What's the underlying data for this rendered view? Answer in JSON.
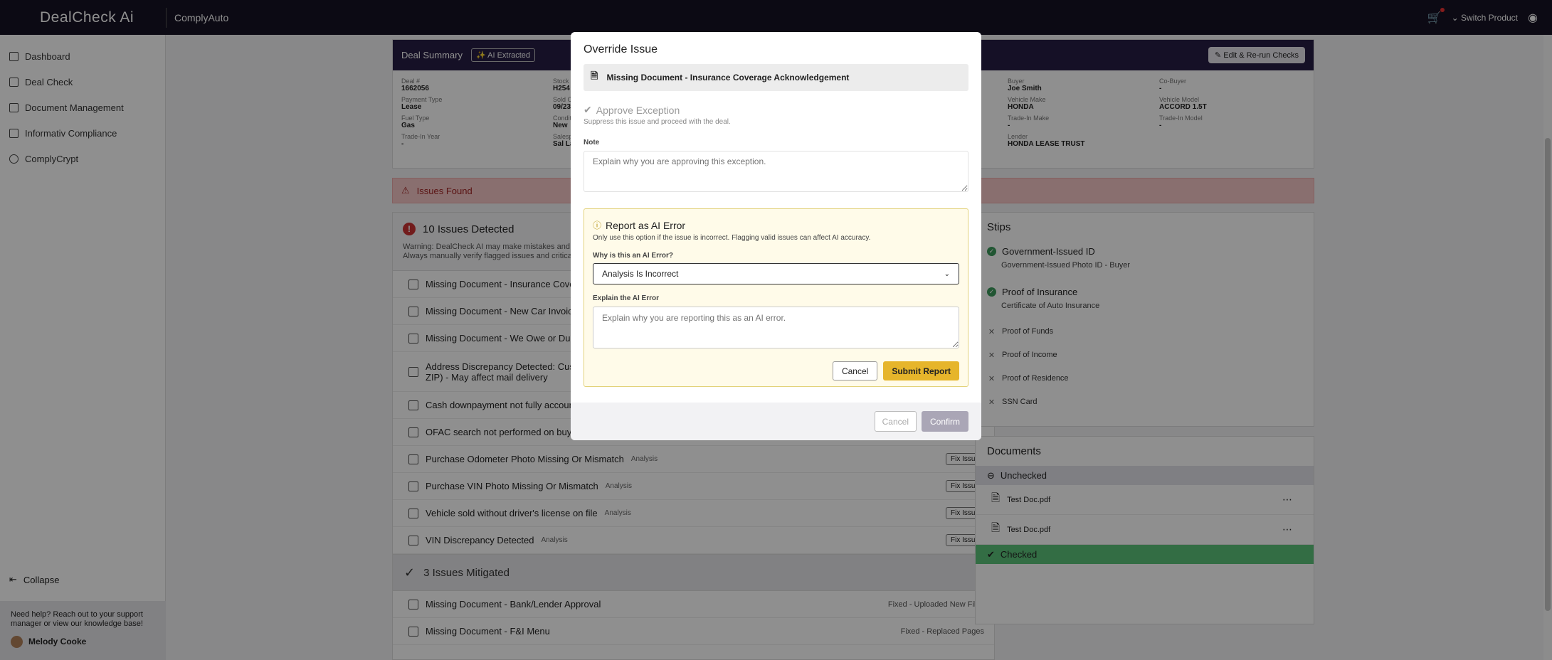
{
  "topbar": {
    "logo": "DealCheck Ai",
    "product": "ComplyAuto",
    "switch_product": "Switch Product"
  },
  "sidebar": {
    "items": [
      {
        "label": "Dashboard"
      },
      {
        "label": "Deal Check"
      },
      {
        "label": "Document Management"
      },
      {
        "label": "Informativ Compliance"
      },
      {
        "label": "ComplyCrypt"
      }
    ],
    "collapse": "Collapse",
    "help": "Need help? Reach out to your support manager or view our knowledge base!",
    "user": "Melody Cooke"
  },
  "summary": {
    "title": "Deal Summary",
    "ai_badge": "AI Extracted",
    "rerun": "Edit & Re-run Checks",
    "fields": [
      {
        "label": "Deal #",
        "value": "1662056"
      },
      {
        "label": "Stock",
        "value": "H254"
      },
      {
        "label": "",
        "value": ""
      },
      {
        "label": "",
        "value": ""
      },
      {
        "label": "Buyer",
        "value": "Joe Smith"
      },
      {
        "label": "Co-Buyer",
        "value": "-"
      },
      {
        "label": "Payment Type",
        "value": "Lease"
      },
      {
        "label": "Sold C",
        "value": "09/23"
      },
      {
        "label": "",
        "value": ""
      },
      {
        "label": "",
        "value": ""
      },
      {
        "label": "Vehicle Make",
        "value": "HONDA"
      },
      {
        "label": "Vehicle Model",
        "value": "ACCORD 1.5T"
      },
      {
        "label": "Fuel Type",
        "value": "Gas"
      },
      {
        "label": "Condit",
        "value": "New"
      },
      {
        "label": "",
        "value": ""
      },
      {
        "label": "",
        "value": ""
      },
      {
        "label": "Trade-In Make",
        "value": "-"
      },
      {
        "label": "Trade-In Model",
        "value": "-"
      },
      {
        "label": "Trade-In Year",
        "value": "-"
      },
      {
        "label": "Salesp",
        "value": "Sal La"
      },
      {
        "label": "",
        "value": ""
      },
      {
        "label": "",
        "value": ""
      },
      {
        "label": "Lender",
        "value": "HONDA LEASE TRUST"
      },
      {
        "label": "",
        "value": ""
      }
    ]
  },
  "issues_bar": "Issues Found",
  "issues": {
    "title": "10 Issues Detected",
    "warning_l1": "Warning: DealCheck AI may make mistakes and te",
    "warning_l2": "Always manually verify flagged issues and critical",
    "rows": [
      {
        "text": "Missing Document - Insurance Covera",
        "tag": "",
        "fix": ""
      },
      {
        "text": "Missing Document - New Car Invoice",
        "tag": "",
        "fix": ""
      },
      {
        "text": "Missing Document - We Owe or Due B",
        "tag": "",
        "fix": ""
      },
      {
        "text": "Address Discrepancy Detected: Custo",
        "text2": "ZIP) - May affect mail delivery",
        "tag": "",
        "fix": ""
      },
      {
        "text": "Cash downpayment not fully account",
        "tag": "",
        "fix": ""
      },
      {
        "text": "OFAC search not performed on buyer",
        "tag": "",
        "fix": ""
      },
      {
        "text": "Purchase Odometer Photo Missing Or Mismatch",
        "tag": "Analysis",
        "fix": "Fix Issue"
      },
      {
        "text": "Purchase VIN Photo Missing Or Mismatch",
        "tag": "Analysis",
        "fix": "Fix Issue"
      },
      {
        "text": "Vehicle sold without driver's license on file",
        "tag": "Analysis",
        "fix": "Fix Issue"
      },
      {
        "text": "VIN Discrepancy Detected",
        "tag": "Analysis",
        "fix": "Fix Issue"
      }
    ],
    "mitigated_title": "3 Issues Mitigated",
    "mitigated": [
      {
        "text": "Missing Document - Bank/Lender Approval",
        "status": "Fixed - Uploaded New Files"
      },
      {
        "text": "Missing Document - F&I Menu",
        "status": "Fixed - Replaced Pages"
      }
    ]
  },
  "stips": {
    "title": "Stips",
    "done": [
      {
        "label": "Government-Issued ID",
        "sub": "Government-Issued Photo ID - Buyer"
      },
      {
        "label": "Proof of Insurance",
        "sub": "Certificate of Auto Insurance"
      }
    ],
    "missing": [
      "Proof of Funds",
      "Proof of Income",
      "Proof of Residence",
      "SSN Card"
    ]
  },
  "documents": {
    "title": "Documents",
    "unchecked": "Unchecked",
    "files": [
      "Test Doc.pdf",
      "Test Doc.pdf"
    ],
    "checked": "Checked"
  },
  "modal": {
    "title": "Override Issue",
    "issue": "Missing Document - Insurance Coverage Acknowledgement",
    "approve_title": "Approve Exception",
    "approve_sub": "Suppress this issue and proceed with the deal.",
    "note_label": "Note",
    "note_placeholder": "Explain why you are approving this exception.",
    "report_title": "Report as AI Error",
    "report_sub": "Only use this option if the issue is incorrect. Flagging valid issues can affect AI accuracy.",
    "why_label": "Why is this an AI Error?",
    "why_value": "Analysis Is Incorrect",
    "explain_label": "Explain the AI Error",
    "explain_placeholder": "Explain why you are reporting this as an AI error.",
    "report_cancel": "Cancel",
    "report_submit": "Submit Report",
    "footer_cancel": "Cancel",
    "footer_confirm": "Confirm"
  }
}
